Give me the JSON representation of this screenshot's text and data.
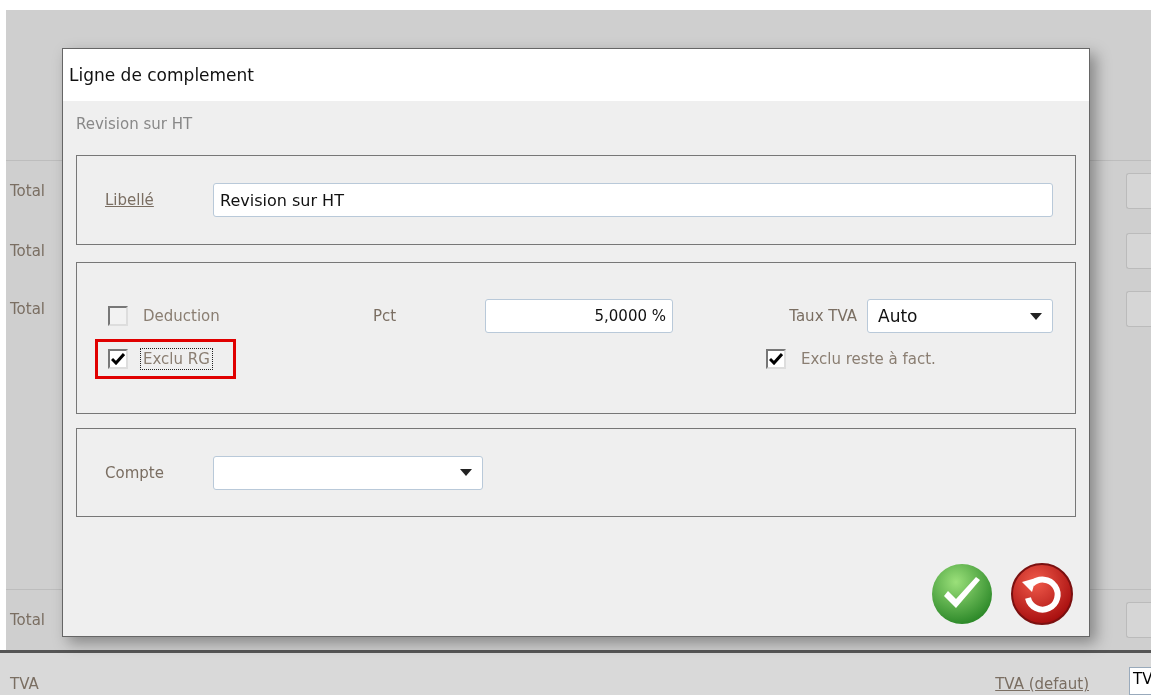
{
  "background": {
    "labels": [
      "Total",
      "Total",
      "Total",
      "Total"
    ],
    "footer": {
      "label": "TVA",
      "link": "TVA (defaut)",
      "field_value": "TV"
    }
  },
  "dialog": {
    "title": "Ligne de complement",
    "subtitle": "Revision sur HT",
    "libelle": {
      "label": "Libellé",
      "value": "Revision sur HT"
    },
    "deduction": {
      "label": "Deduction",
      "checked": false
    },
    "pct": {
      "label": "Pct",
      "value": "5,0000 %"
    },
    "taux_tva": {
      "label": "Taux TVA",
      "value": "Auto"
    },
    "exclu_rg": {
      "label": "Exclu RG",
      "checked": true,
      "focused": true,
      "highlighted": true
    },
    "exclu_reste": {
      "label": "Exclu reste à fact.",
      "checked": true
    },
    "compte": {
      "label": "Compte"
    },
    "buttons": [
      {
        "kind": "ok"
      },
      {
        "kind": "cancel"
      }
    ]
  }
}
